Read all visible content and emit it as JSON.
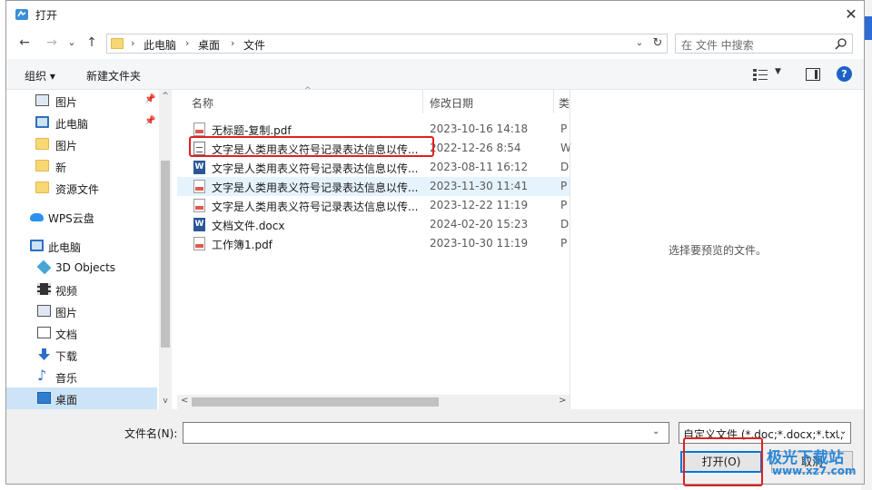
{
  "dialog": {
    "title": "打开",
    "close_glyph": "✕"
  },
  "nav_buttons": {
    "back": "←",
    "forward": "→",
    "dropdown": "⌄",
    "up": "↑"
  },
  "address": {
    "crumbs": [
      "此电脑",
      "桌面",
      "文件"
    ],
    "separator": "›",
    "dropdown": "⌄",
    "refresh": "↻"
  },
  "search": {
    "placeholder": "在 文件 中搜索"
  },
  "toolbar": {
    "organize": "组织 ▾",
    "new_folder": "新建文件夹",
    "view_dropdown": "▼",
    "help": "?"
  },
  "sidebar": {
    "items": [
      {
        "label": "图片",
        "icon": "pictures-icon",
        "pinned": true
      },
      {
        "label": "此电脑",
        "icon": "computer-icon",
        "pinned": true
      },
      {
        "label": "图片",
        "icon": "folder-icon"
      },
      {
        "label": "新",
        "icon": "folder-icon"
      },
      {
        "label": "资源文件",
        "icon": "folder-icon"
      },
      {
        "label": "WPS云盘",
        "icon": "cloud-icon"
      },
      {
        "label": "此电脑",
        "icon": "computer-icon"
      },
      {
        "label": "3D Objects",
        "icon": "cube-icon"
      },
      {
        "label": "视频",
        "icon": "video-icon"
      },
      {
        "label": "图片",
        "icon": "pictures-icon"
      },
      {
        "label": "文档",
        "icon": "documents-icon"
      },
      {
        "label": "下载",
        "icon": "download-icon"
      },
      {
        "label": "音乐",
        "icon": "music-icon"
      },
      {
        "label": "桌面",
        "icon": "desktop-icon",
        "selected": true
      }
    ],
    "pin_glyph": "📌",
    "music_glyph": "♪",
    "scroll_up": "^",
    "scroll_down": "v"
  },
  "file_list": {
    "columns": [
      "名称",
      "修改日期",
      "类"
    ],
    "sort_caret": "^",
    "rows": [
      {
        "name": "无标题-复制.pdf",
        "date": "2023-10-16 14:18",
        "type": "P",
        "icon": "pdf"
      },
      {
        "name": "文字是人类用表义符号记录表达信息以传...",
        "date": "2022-12-26 8:54",
        "type": "W",
        "icon": "txt"
      },
      {
        "name": "文字是人类用表义符号记录表达信息以传...",
        "date": "2023-08-11 16:12",
        "type": "D",
        "icon": "docx"
      },
      {
        "name": "文字是人类用表义符号记录表达信息以传...",
        "date": "2023-11-30 11:41",
        "type": "P",
        "icon": "pdf",
        "highlighted": true
      },
      {
        "name": "文字是人类用表义符号记录表达信息以传...",
        "date": "2023-12-22 11:19",
        "type": "P",
        "icon": "pdf"
      },
      {
        "name": "文档文件.docx",
        "date": "2024-02-20 15:23",
        "type": "D",
        "icon": "docx"
      },
      {
        "name": "工作簿1.pdf",
        "date": "2023-10-30 11:19",
        "type": "P",
        "icon": "pdf"
      }
    ],
    "docx_glyph": "W",
    "scroll_left": "<",
    "scroll_right": ">"
  },
  "preview": {
    "text": "选择要预览的文件。"
  },
  "bottom": {
    "filename_label": "文件名(N):",
    "filename_value": "",
    "filename_dropdown": "⌄",
    "filter_text": "自定义文件 (*.doc;*.docx;*.txt;",
    "filter_dropdown": "⌄",
    "open_button": "打开(O)",
    "cancel_button": "取消"
  },
  "watermark": {
    "title": "极光下载站",
    "url": "www.xz7.com"
  },
  "colors": {
    "accent": "#0078d7",
    "highlight_row": "#e5f3ff",
    "selected_nav": "#cce4f7",
    "annotation_red": "#e02020"
  }
}
